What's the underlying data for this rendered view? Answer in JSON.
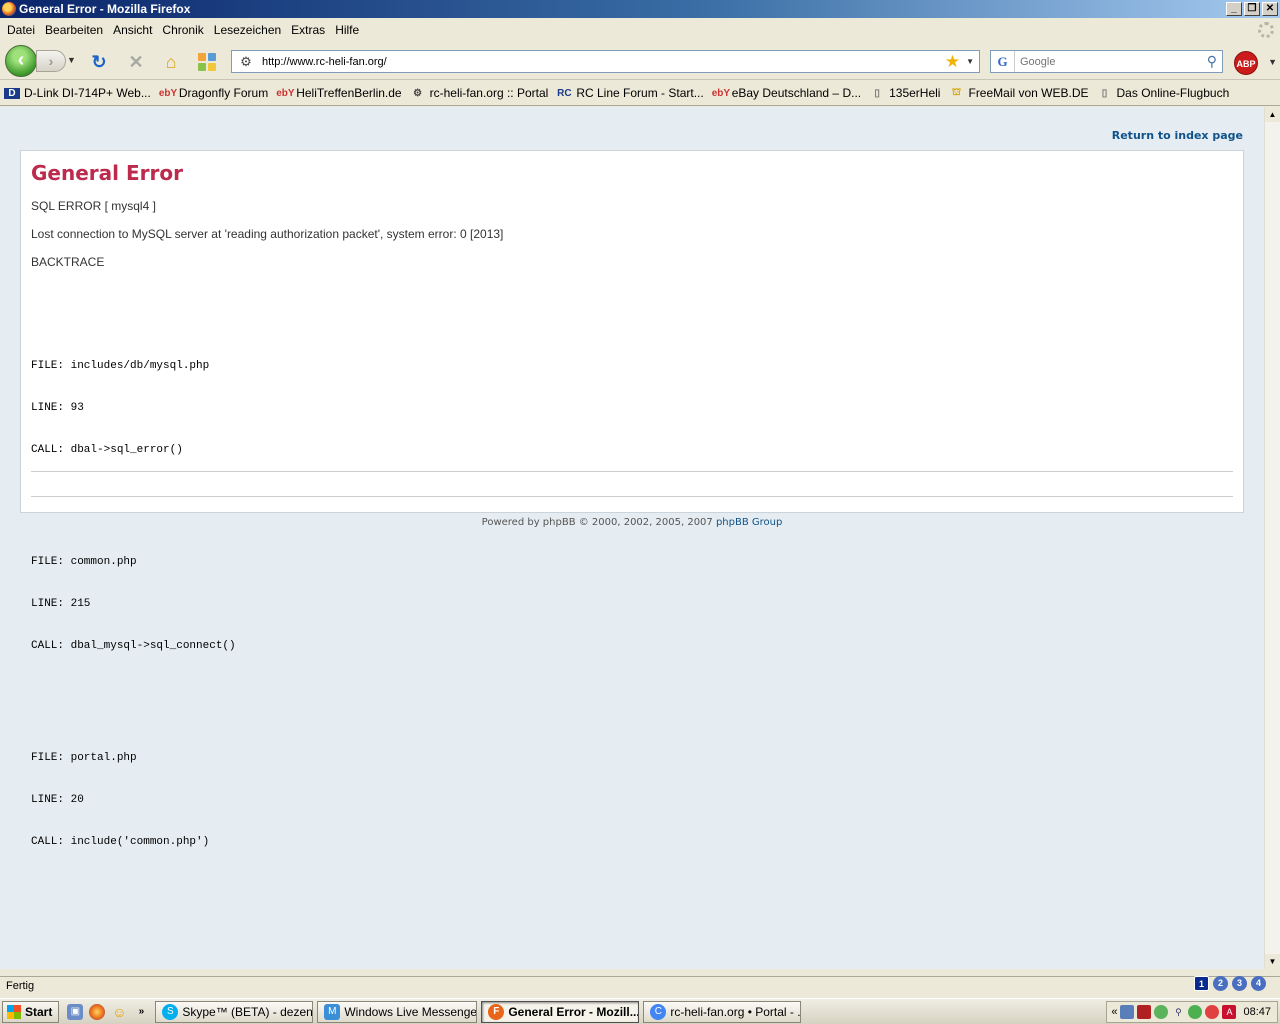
{
  "window": {
    "title": "General Error - Mozilla Firefox",
    "buttons": {
      "minimize": "_",
      "maximize": "❐",
      "close": "✕"
    }
  },
  "menu": [
    "Datei",
    "Bearbeiten",
    "Ansicht",
    "Chronik",
    "Lesezeichen",
    "Extras",
    "Hilfe"
  ],
  "navigation": {
    "url": "http://www.rc-heli-fan.org/",
    "search_placeholder": "Google",
    "search_engine_icon": "G",
    "adblock_label": "ABP"
  },
  "bookmarks": [
    {
      "label": "D-Link DI-714P+ Web...",
      "icon": "D"
    },
    {
      "label": "Dragonfly Forum",
      "icon": "ebY"
    },
    {
      "label": "HeliTreffenBerlin.de",
      "icon": "ebY"
    },
    {
      "label": "rc-heli-fan.org :: Portal",
      "icon": "heli"
    },
    {
      "label": "RC Line Forum - Start...",
      "icon": "RC"
    },
    {
      "label": "eBay Deutschland – D...",
      "icon": "ebY"
    },
    {
      "label": "135erHeli",
      "icon": "page"
    },
    {
      "label": "FreeMail von WEB.DE",
      "icon": "web"
    },
    {
      "label": "Das Online-Flugbuch",
      "icon": "page"
    }
  ],
  "page": {
    "return_link": "Return to index page",
    "heading": "General Error",
    "sql_error": "SQL ERROR [ mysql4 ]",
    "error_message": "Lost connection to MySQL server at 'reading authorization packet', system error: 0 [2013]",
    "backtrace_label": "BACKTRACE",
    "backtrace": [
      {
        "file": "FILE: includes/db/mysql.php",
        "line": "LINE: 93",
        "call": "CALL: dbal->sql_error()"
      },
      {
        "file": "FILE: common.php",
        "line": "LINE: 215",
        "call": "CALL: dbal_mysql->sql_connect()"
      },
      {
        "file": "FILE: portal.php",
        "line": "LINE: 20",
        "call": "CALL: include('common.php')"
      }
    ],
    "footer_prefix": "Powered by phpBB © 2000, 2002, 2005, 2007 ",
    "footer_link": "phpBB Group"
  },
  "status": {
    "text": "Fertig",
    "desktops": [
      "1",
      "2",
      "3",
      "4"
    ]
  },
  "taskbar": {
    "start_label": "Start",
    "tasks": [
      {
        "label": "Skype™ (BETA) - dezender",
        "icon": "S",
        "color": "#00aff0"
      },
      {
        "label": "Windows Live Messenger",
        "icon": "M",
        "color": "#3a8fd6"
      },
      {
        "label": "General Error - Mozill...",
        "icon": "F",
        "color": "#e8651a"
      },
      {
        "label": "rc-heli-fan.org • Portal - ...",
        "icon": "C",
        "color": "#4285f4"
      }
    ],
    "clock": "08:47"
  }
}
